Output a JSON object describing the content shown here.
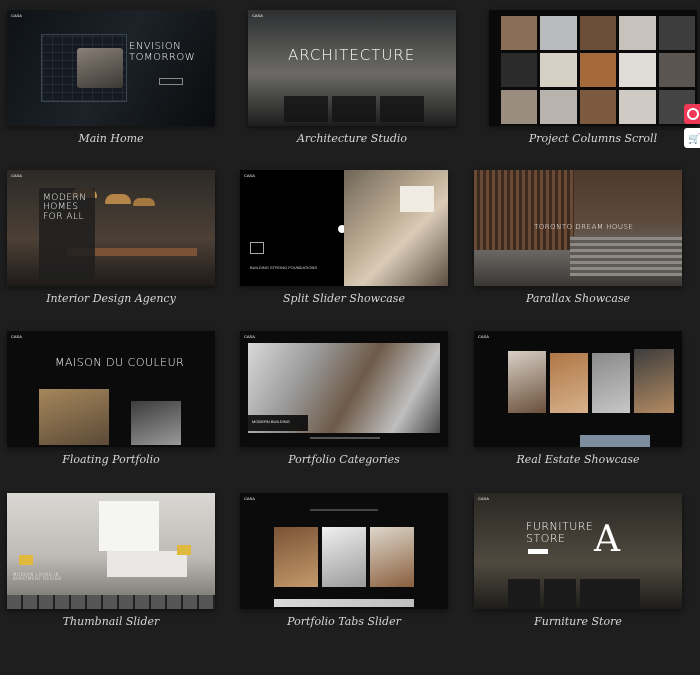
{
  "demos": [
    {
      "caption": "Main Home",
      "overlay": [
        "ENVISION",
        "TOMORROW"
      ]
    },
    {
      "caption": "Architecture Studio",
      "overlay": [
        "ARCHITECTURE"
      ]
    },
    {
      "caption": "Project Columns Scroll",
      "overlay": []
    },
    {
      "caption": "Interior Design Agency",
      "overlay": [
        "MODERN",
        "HOMES",
        "FOR ALL"
      ]
    },
    {
      "caption": "Split Slider Showcase",
      "overlay": [
        "BUILDING STRONG FOUNDATIONS"
      ]
    },
    {
      "caption": "Parallax Showcase",
      "overlay": [
        "TORONTO DREAM HOUSE"
      ]
    },
    {
      "caption": "Floating Portfolio",
      "overlay": [
        "MAISON DU COULEUR"
      ]
    },
    {
      "caption": "Portfolio Categories",
      "overlay": [
        "MODERN BUILDING"
      ]
    },
    {
      "caption": "Real Estate Showcase",
      "overlay": []
    },
    {
      "caption": "Thumbnail Slider",
      "overlay": [
        "MODERN LIVING IN",
        "APARTMENT DESIGN"
      ]
    },
    {
      "caption": "Portfolio Tabs Slider",
      "overlay": []
    },
    {
      "caption": "Furniture Store",
      "overlay": [
        "FURNITURE",
        "STORE",
        "A"
      ]
    }
  ],
  "side_buttons": {
    "top_color": "#ef3a57",
    "bottom_color": "#ffffff"
  },
  "icons": {
    "top": "life-ring-icon",
    "bottom": "cart-icon"
  },
  "colors": {
    "background": "#1e1e1e",
    "caption": "#d8d8d8"
  }
}
